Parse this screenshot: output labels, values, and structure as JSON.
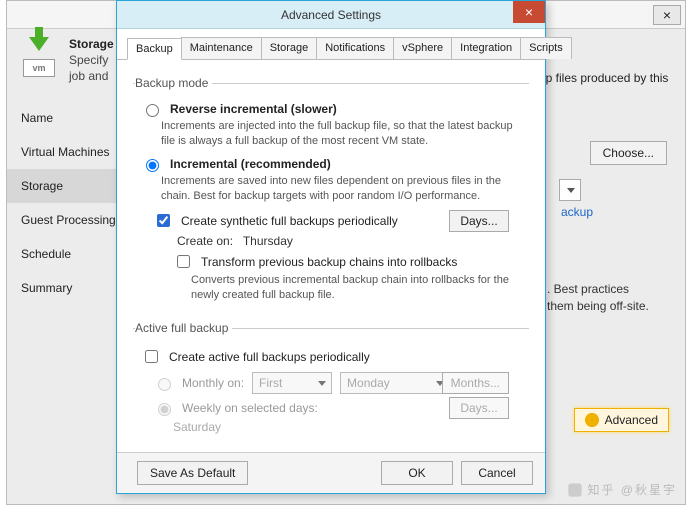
{
  "parent": {
    "close_glyph": "×",
    "header_title": "Storage",
    "header_desc_left": "Specify",
    "header_desc_right": "up files produced by this",
    "header_desc_line2": "job and",
    "icon_vm_label": "vm",
    "sidebar": [
      "Name",
      "Virtual Machines",
      "Storage",
      "Guest Processing",
      "Schedule",
      "Summary"
    ],
    "choose_btn": "Choose...",
    "link_text": "ackup",
    "best_line1": ". Best practices",
    "best_line2": "them being off-site.",
    "advanced_btn": "Advanced"
  },
  "dialog": {
    "title": "Advanced Settings",
    "close_glyph": "×",
    "tabs": [
      "Backup",
      "Maintenance",
      "Storage",
      "Notifications",
      "vSphere",
      "Integration",
      "Scripts"
    ],
    "backup_mode_legend": "Backup mode",
    "reverse_label": "Reverse incremental (slower)",
    "reverse_desc": "Increments are injected into the full backup file, so that the latest backup file is always a full backup of the most recent VM state.",
    "incremental_label": "Incremental (recommended)",
    "incremental_desc": "Increments are saved into new files dependent on previous files in the chain. Best for backup targets with poor random I/O performance.",
    "synthetic_chk": "Create synthetic full backups periodically",
    "days_btn": "Days...",
    "create_on_label": "Create on:",
    "create_on_value": "Thursday",
    "transform_chk": "Transform previous backup chains into rollbacks",
    "transform_desc": "Converts previous incremental backup chain into rollbacks for the newly created full backup file.",
    "active_legend": "Active full backup",
    "active_chk": "Create active full backups periodically",
    "monthly_label": "Monthly on:",
    "monthly_first": "First",
    "monthly_day": "Monday",
    "months_btn": "Months...",
    "weekly_label": "Weekly on selected days:",
    "weekly_days_btn": "Days...",
    "weekly_day": "Saturday",
    "save_default_btn": "Save As Default",
    "ok_btn": "OK",
    "cancel_btn": "Cancel"
  },
  "watermark": "知乎 @秋星宇"
}
